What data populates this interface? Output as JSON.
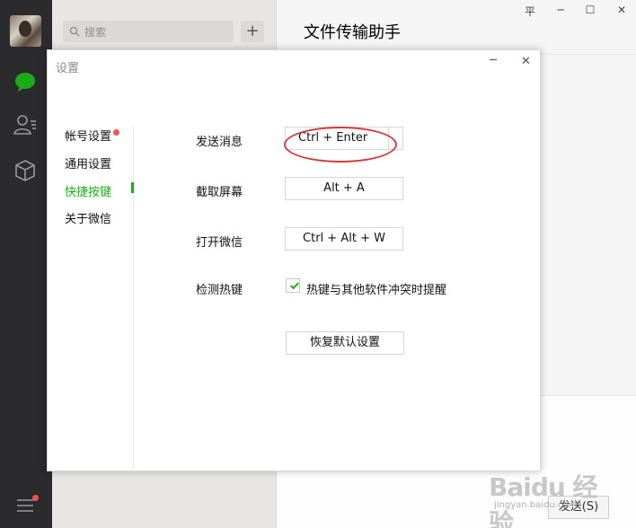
{
  "sidebar": {
    "icons": [
      "chat-icon",
      "contacts-icon",
      "mini-program-box-icon",
      "menu-icon"
    ],
    "accent_color": "#1aad19",
    "badge_color": "#fa5151"
  },
  "session_list": {
    "search_placeholder": "搜索",
    "add_label": "+"
  },
  "chat": {
    "title": "文件传输助手",
    "send_label": "发送(S)"
  },
  "window_controls": {
    "pin": "平",
    "minimize": "─",
    "maximize": "☐",
    "close": "✕"
  },
  "settings_dialog": {
    "title": "设置",
    "minimize": "─",
    "close": "✕",
    "nav": [
      {
        "label": "帐号设置",
        "active": false
      },
      {
        "label": "通用设置",
        "active": false
      },
      {
        "label": "快捷按键",
        "active": true
      },
      {
        "label": "关于微信",
        "active": false,
        "badge": true
      }
    ],
    "shortcuts": [
      {
        "label": "发送消息",
        "value": "Ctrl + Enter"
      },
      {
        "label": "截取屏幕",
        "value": "Alt + A"
      },
      {
        "label": "打开微信",
        "value": "Ctrl + Alt + W"
      }
    ],
    "hotkey_check": {
      "label": "检测热键",
      "option": "热键与其他软件冲突时提醒",
      "checked": true
    },
    "reset_label": "恢复默认设置"
  },
  "watermark": {
    "text": "Baidu 经验",
    "sub": "jingyan.baidu.com"
  }
}
